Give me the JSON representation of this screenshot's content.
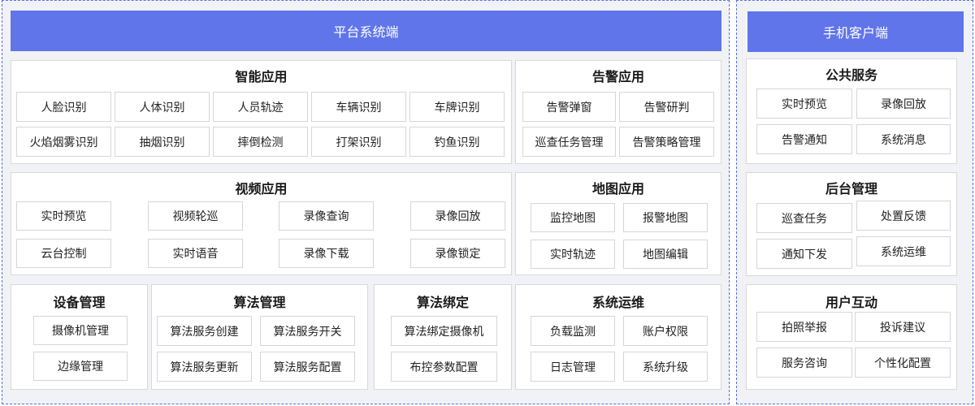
{
  "platform": {
    "title": "平台系统端",
    "smart_app": {
      "title": "智能应用",
      "items": [
        "人脸识别",
        "人体识别",
        "人员轨迹",
        "车辆识别",
        "车牌识别",
        "火焰烟雾识别",
        "抽烟识别",
        "摔倒检测",
        "打架识别",
        "钓鱼识别"
      ]
    },
    "alarm_app": {
      "title": "告警应用",
      "items": [
        "告警弹窗",
        "告警研判",
        "巡查任务管理",
        "告警策略管理"
      ]
    },
    "video_app": {
      "title": "视频应用",
      "items": [
        "实时预览",
        "视频轮巡",
        "录像查询",
        "录像回放",
        "云台控制",
        "实时语音",
        "录像下载",
        "录像锁定"
      ]
    },
    "map_app": {
      "title": "地图应用",
      "items": [
        "监控地图",
        "报警地图",
        "实时轨迹",
        "地图编辑"
      ]
    },
    "device_mgmt": {
      "title": "设备管理",
      "items": [
        "摄像机管理",
        "边缘管理"
      ]
    },
    "algo_mgmt": {
      "title": "算法管理",
      "items": [
        "算法服务创建",
        "算法服务开关",
        "算法服务更新",
        "算法服务配置"
      ]
    },
    "algo_bind": {
      "title": "算法绑定",
      "items": [
        "算法绑定摄像机",
        "布控参数配置"
      ]
    },
    "sys_ops": {
      "title": "系统运维",
      "items": [
        "负载监测",
        "账户权限",
        "日志管理",
        "系统升级"
      ]
    }
  },
  "mobile": {
    "title": "手机客户端",
    "public_service": {
      "title": "公共服务",
      "items": [
        "实时预览",
        "录像回放",
        "告警通知",
        "系统消息"
      ]
    },
    "backend_mgmt": {
      "title": "后台管理",
      "items": [
        "巡查任务",
        "处置反馈",
        "通知下发",
        "系统运维"
      ]
    },
    "user_interact": {
      "title": "用户互动",
      "items": [
        "拍照举报",
        "投诉建议",
        "服务咨询",
        "个性化配置"
      ]
    }
  },
  "colors": {
    "banner": "#6075ea",
    "region_bg": "#f1f2f5",
    "region_border": "#5b6ee6"
  }
}
